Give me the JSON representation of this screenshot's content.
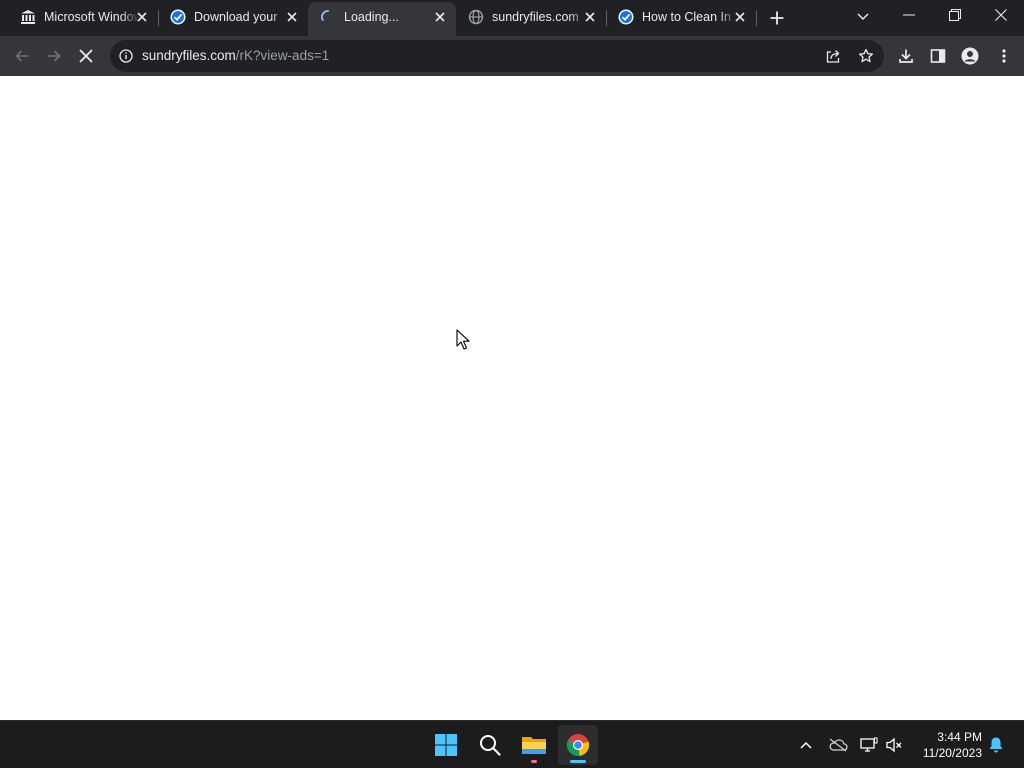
{
  "browser": {
    "tabs": [
      {
        "title": "Microsoft Windows",
        "favicon": "bank-building-icon",
        "active": false
      },
      {
        "title": "Download your",
        "favicon": "check-badge-icon",
        "active": false
      },
      {
        "title": "Loading...",
        "favicon": "loading-spinner-icon",
        "active": true
      },
      {
        "title": "sundryfiles.com",
        "favicon": "globe-icon",
        "active": false
      },
      {
        "title": "How to Clean In",
        "favicon": "check-badge-icon",
        "active": false
      }
    ],
    "omnibox": {
      "host": "sundryfiles.com",
      "path": "/rK?view-ads=1"
    }
  },
  "taskbar": {
    "apps": [
      "windows-start",
      "search",
      "file-explorer",
      "chrome"
    ],
    "clock": {
      "time": "3:44 PM",
      "date": "11/20/2023"
    }
  },
  "colors": {
    "tabstrip": "#202124",
    "toolbar": "#35363a",
    "omnibox": "#202124",
    "taskbar": "#1c1c1c",
    "accent_blue": "#4cc2ff"
  }
}
